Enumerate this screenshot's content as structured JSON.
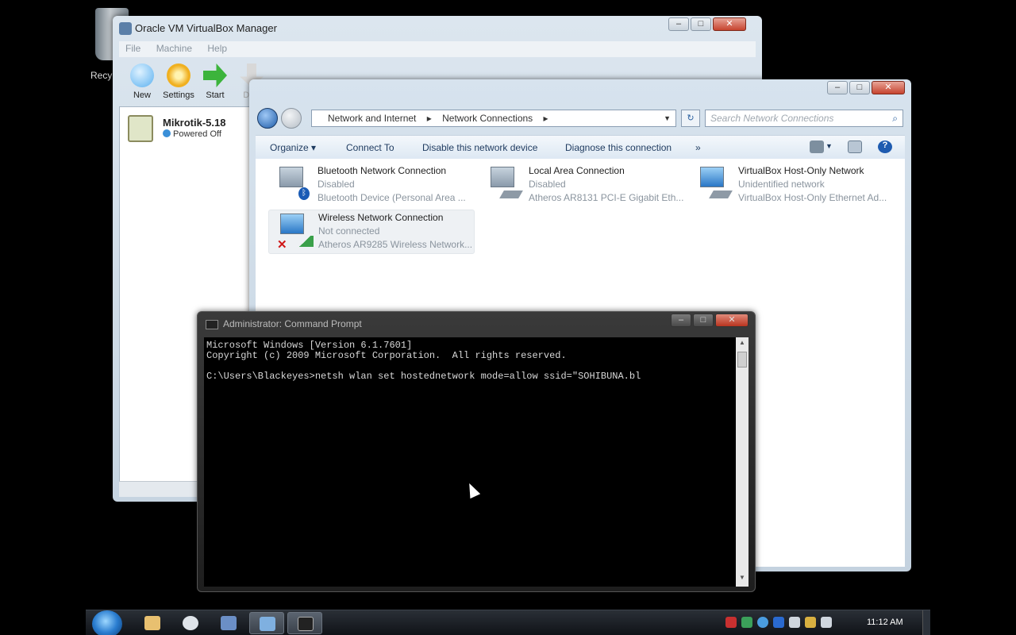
{
  "desktop": {
    "recycle_bin_label": "Recy"
  },
  "vbox": {
    "title": "Oracle VM VirtualBox Manager",
    "menu": [
      "File",
      "Machine",
      "Help"
    ],
    "toolbar": [
      {
        "label": "New",
        "icon": "new-icon",
        "color": "#5ab0f0"
      },
      {
        "label": "Settings",
        "icon": "gear-icon",
        "color": "#f0b020"
      },
      {
        "label": "Start",
        "icon": "start-arrow-icon",
        "color": "#3cb43c"
      },
      {
        "label": "Disc",
        "icon": "discard-icon",
        "color": "#c8c8c8"
      }
    ],
    "vm": {
      "name": "Mikrotik-5.18",
      "state": "Powered Off"
    }
  },
  "explorer": {
    "breadcrumb": [
      "Network and Internet",
      "Network Connections"
    ],
    "search_placeholder": "Search Network Connections",
    "commands": [
      "Organize",
      "Connect To",
      "Disable this network device",
      "Diagnose this connection",
      "»"
    ],
    "connections": [
      {
        "name": "Bluetooth Network Connection",
        "status": "Disabled",
        "device": "Bluetooth Device (Personal Area ..."
      },
      {
        "name": "Local Area Connection",
        "status": "Disabled",
        "device": "Atheros AR8131 PCI-E Gigabit Eth..."
      },
      {
        "name": "VirtualBox Host-Only Network",
        "status": "Unidentified network",
        "device": "VirtualBox Host-Only Ethernet Ad..."
      },
      {
        "name": "Wireless Network Connection",
        "status": "Not connected",
        "device": "Atheros AR9285 Wireless Network..."
      }
    ]
  },
  "cmd": {
    "title": "Administrator: Command Prompt",
    "lines": [
      "Microsoft Windows [Version 6.1.7601]",
      "Copyright (c) 2009 Microsoft Corporation.  All rights reserved.",
      "",
      "C:\\Users\\Blackeyes>netsh wlan set hostednetwork mode=allow ssid=\"SOHIBUNA.bl"
    ]
  },
  "taskbar": {
    "time": "11:12 AM"
  }
}
